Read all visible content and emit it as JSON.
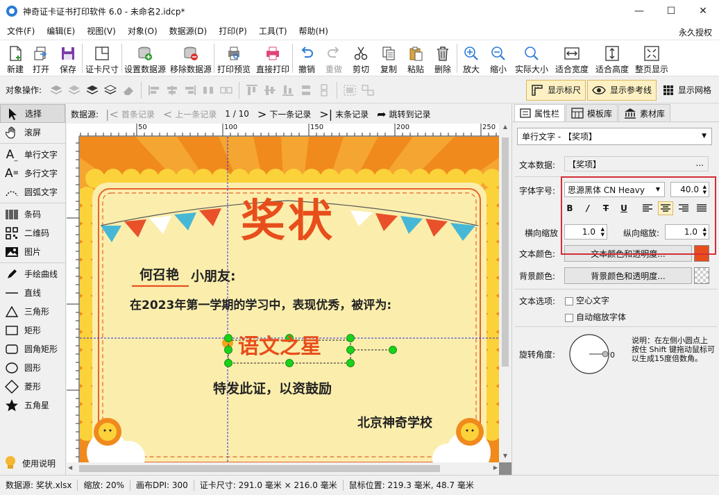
{
  "window": {
    "title": "神奇证卡证书打印软件 6.0 - 未命名2.idcp*"
  },
  "menu": {
    "items": [
      "文件(F)",
      "编辑(E)",
      "视图(V)",
      "对象(O)",
      "数据源(D)",
      "打印(P)",
      "工具(T)",
      "帮助(H)"
    ],
    "right": "永久授权"
  },
  "toolbar": {
    "new": "新建",
    "open": "打开",
    "save": "保存",
    "card_size": "证卡尺寸",
    "set_ds": "设置数据源",
    "remove_ds": "移除数据源",
    "print_preview": "打印预览",
    "direct_print": "直接打印",
    "undo": "撤销",
    "redo": "重做",
    "cut": "剪切",
    "copy": "复制",
    "paste": "粘贴",
    "delete": "删除",
    "zoom_in": "放大",
    "zoom_out": "缩小",
    "actual": "实际大小",
    "fit_width": "适合宽度",
    "fit_height": "适合高度",
    "full_page": "整页显示"
  },
  "objbar": {
    "label": "对象操作:",
    "show_ruler": "显示标尺",
    "show_guides": "显示参考线",
    "show_grid": "显示网格"
  },
  "tools": [
    "选择",
    "滚屏",
    "单行文字",
    "多行文字",
    "圆弧文字",
    "条码",
    "二维码",
    "图片",
    "手绘曲线",
    "直线",
    "三角形",
    "矩形",
    "圆角矩形",
    "圆形",
    "菱形",
    "五角星"
  ],
  "help": "使用说明",
  "nav": {
    "label": "数据源:",
    "first": "首条记录",
    "prev": "上一条记录",
    "record": "1 / 10",
    "next": "下一条记录",
    "last": "末条记录",
    "jump": "跳转到记录"
  },
  "ruler": {
    "marks": [
      "50",
      "100",
      "150",
      "200",
      "250"
    ]
  },
  "certificate": {
    "title": "奖状",
    "name": "何召艳",
    "salutation": "小朋友:",
    "body": "在2023年第一学期的学习中，表现优秀，被评为:",
    "award": "语文之星",
    "closing": "特发此证，以资鼓励",
    "school": "北京神奇学校"
  },
  "panel": {
    "tabs": [
      "属性栏",
      "模板库",
      "素材库"
    ],
    "object": "单行文字 - 【奖项】",
    "text_data_label": "文本数据:",
    "text_data": "【奖项】",
    "font_label": "字体字号:",
    "font": "思源黑体 CN Heavy",
    "size": "40.0",
    "h_scale_label": "横向缩放",
    "h_scale": "1.0",
    "v_scale_label": "纵向缩放:",
    "v_scale": "1.0",
    "color_label": "文本颜色:",
    "color_btn": "文本颜色和透明度...",
    "bg_label": "背景颜色:",
    "bg_btn": "背景颜色和透明度...",
    "options_label": "文本选项:",
    "hollow": "空心文字",
    "autoscale": "自动缩放字体",
    "rotate_label": "旋转角度:",
    "rotate_value": "0",
    "rotate_hint": "说明：在左侧小圆点上按住 Shift 键拖动鼠标可以生成15度倍数角。"
  },
  "colors": {
    "text_color": "#e84e1b"
  },
  "status": {
    "datasource": "数据源: 奖状.xlsx",
    "zoom": "缩放: 20%",
    "dpi": "画布DPI: 300",
    "size": "证卡尺寸: 291.0 毫米 × 216.0 毫米",
    "mouse": "鼠标位置: 219.3 毫米, 48.7 毫米"
  }
}
